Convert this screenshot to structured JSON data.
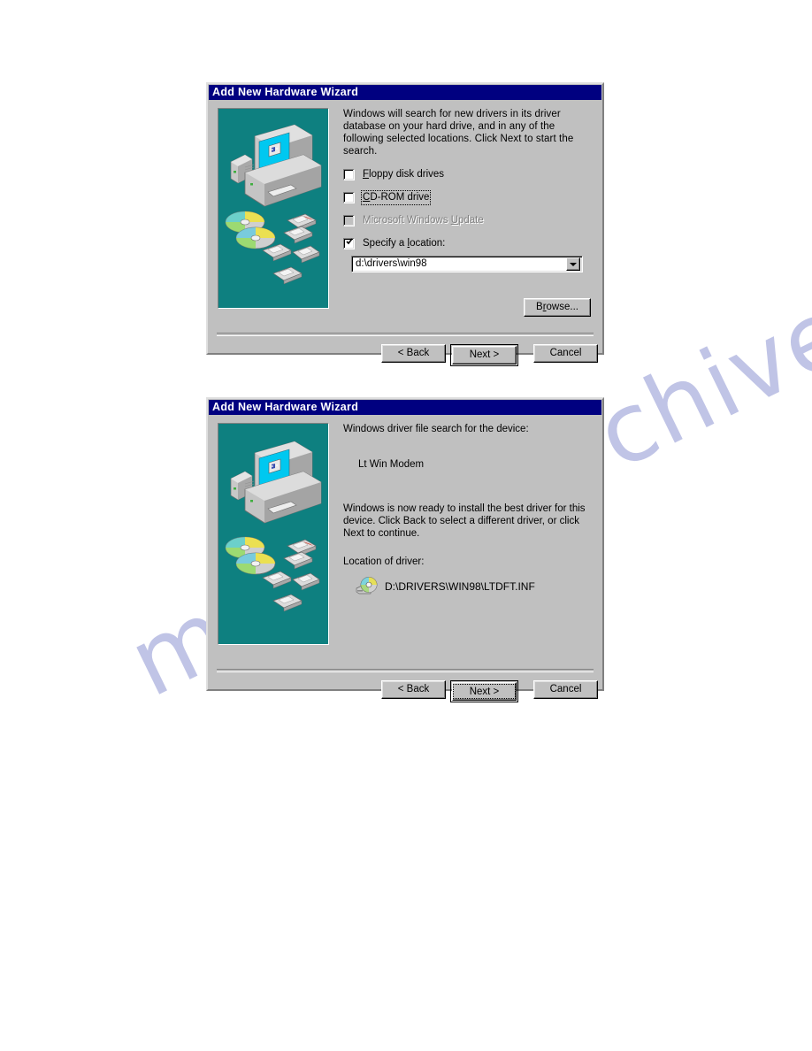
{
  "page": {
    "watermark": "manualsarchive.com"
  },
  "dialog1": {
    "title": "Add New Hardware Wizard",
    "intro": "Windows will search for new drivers in its driver database on your hard drive, and in any of the following selected locations. Click Next to start the search.",
    "checkboxes": [
      {
        "label": "Floppy disk drives",
        "accel": "F",
        "checked": false,
        "disabled": false,
        "focused": false
      },
      {
        "label": "CD-ROM drive",
        "accel": "C",
        "checked": false,
        "disabled": false,
        "focused": true
      },
      {
        "label": "Microsoft Windows Update",
        "accel": "U",
        "checked": false,
        "disabled": true,
        "focused": false
      },
      {
        "label": "Specify a location:",
        "accel": "l",
        "checked": true,
        "disabled": false,
        "focused": false
      }
    ],
    "location_value": "d:\\drivers\\win98",
    "browse_label": "Browse...",
    "buttons": {
      "back": "< Back",
      "next": "Next >",
      "cancel": "Cancel"
    }
  },
  "dialog2": {
    "title": "Add New Hardware Wizard",
    "search_label": "Windows driver file search for the device:",
    "device_name": "Lt Win Modem",
    "ready_text": "Windows is now ready to install the best driver for this device. Click Back to select a different driver, or click Next to continue.",
    "location_label": "Location of driver:",
    "driver_path": "D:\\DRIVERS\\WIN98\\LTDFT.INF",
    "buttons": {
      "back": "< Back",
      "next": "Next >",
      "cancel": "Cancel"
    }
  },
  "colors": {
    "titlebar": "#000080",
    "dialog_face": "#c0c0c0",
    "art_background": "#0e8080",
    "screen": "#00c8f0",
    "watermark": "#b6bae2"
  }
}
